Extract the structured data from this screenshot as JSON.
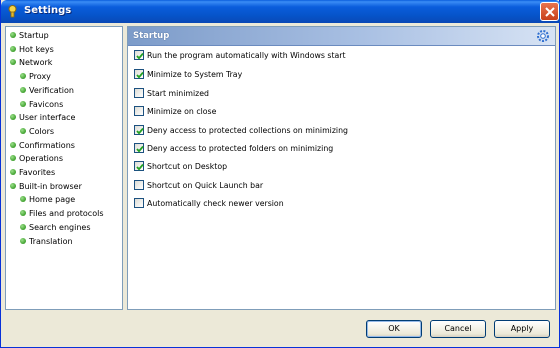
{
  "window": {
    "title": "Settings"
  },
  "tree": {
    "items": [
      {
        "label": "Startup",
        "level": 0
      },
      {
        "label": "Hot keys",
        "level": 0
      },
      {
        "label": "Network",
        "level": 0
      },
      {
        "label": "Proxy",
        "level": 1
      },
      {
        "label": "Verification",
        "level": 1
      },
      {
        "label": "Favicons",
        "level": 1
      },
      {
        "label": "User interface",
        "level": 0
      },
      {
        "label": "Colors",
        "level": 1
      },
      {
        "label": "Confirmations",
        "level": 0
      },
      {
        "label": "Operations",
        "level": 0
      },
      {
        "label": "Favorites",
        "level": 0
      },
      {
        "label": "Built-in browser",
        "level": 0
      },
      {
        "label": "Home page",
        "level": 1
      },
      {
        "label": "Files and protocols",
        "level": 1
      },
      {
        "label": "Search engines",
        "level": 1
      },
      {
        "label": "Translation",
        "level": 1
      }
    ]
  },
  "content": {
    "header": "Startup",
    "options": [
      {
        "label": "Run the program automatically with Windows start",
        "checked": true
      },
      {
        "label": "Minimize to System Tray",
        "checked": true
      },
      {
        "label": "Start minimized",
        "checked": false
      },
      {
        "label": "Minimize on close",
        "checked": false
      },
      {
        "label": "Deny access to protected collections on minimizing",
        "checked": true
      },
      {
        "label": "Deny access to protected folders on minimizing",
        "checked": true
      },
      {
        "label": "Shortcut on Desktop",
        "checked": true
      },
      {
        "label": "Shortcut on Quick Launch bar",
        "checked": false
      },
      {
        "label": "Automatically check newer version",
        "checked": false
      }
    ]
  },
  "buttons": {
    "ok": "OK",
    "cancel": "Cancel",
    "apply": "Apply"
  },
  "colors": {
    "check": "#21a121",
    "bullet": "#3fa02e",
    "title_bar": "#0a5ddc"
  }
}
